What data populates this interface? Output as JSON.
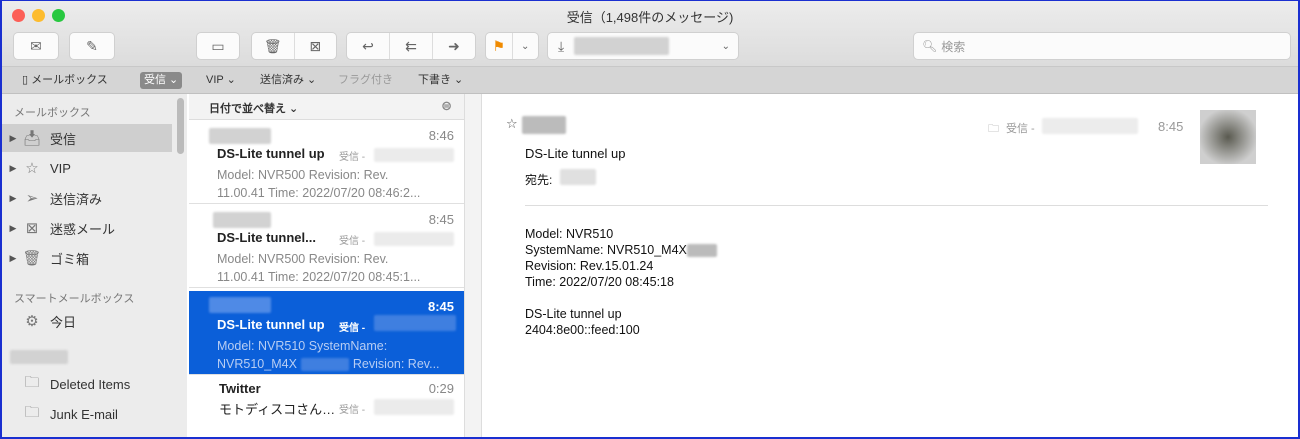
{
  "window": {
    "title": "受信（1,498件のメッセージ)"
  },
  "toolbar": {
    "search_placeholder": "検索"
  },
  "favorites": [
    {
      "label": "メールボックス"
    },
    {
      "label": "受信 ⌄"
    },
    {
      "label": "VIP ⌄"
    },
    {
      "label": "送信済み ⌄"
    },
    {
      "label": "フラグ付き"
    },
    {
      "label": "下書き ⌄"
    }
  ],
  "sidebar": {
    "section_mailboxes": "メールボックス",
    "items": [
      {
        "label": "受信",
        "icon": "inbox-icon"
      },
      {
        "label": "VIP",
        "icon": "star-icon"
      },
      {
        "label": "送信済み",
        "icon": "paperplane-icon"
      },
      {
        "label": "迷惑メール",
        "icon": "junk-icon"
      },
      {
        "label": "ゴミ箱",
        "icon": "trash-icon"
      }
    ],
    "section_smart": "スマートメールボックス",
    "smart_items": [
      {
        "label": "今日"
      }
    ],
    "account_items": [
      {
        "label": "Deleted Items"
      },
      {
        "label": "Junk E-mail"
      }
    ]
  },
  "list": {
    "sort_label": "日付で並べ替え ⌄",
    "messages": [
      {
        "time": "8:46",
        "subject": "DS-Lite tunnel up",
        "mailbox": "受信 -",
        "preview1": "Model: NVR500 Revision: Rev.",
        "preview2": "11.00.41 Time: 2022/07/20 08:46:2..."
      },
      {
        "time": "8:45",
        "subject": "DS-Lite tunnel...",
        "mailbox": "受信 -",
        "preview1": "Model: NVR500 Revision: Rev.",
        "preview2": "11.00.41 Time: 2022/07/20 08:45:1..."
      },
      {
        "time": "8:45",
        "subject": "DS-Lite tunnel up",
        "mailbox": "受信 -",
        "preview1": "Model: NVR510 SystemName:",
        "preview2": "NVR510_M4X",
        "preview2b": "Revision: Rev..."
      },
      {
        "sender": "Twitter",
        "time": "0:29",
        "subject": "モトディスコさん…",
        "mailbox": "受信 -"
      }
    ]
  },
  "detail": {
    "mailbox": "受信 -",
    "time": "8:45",
    "subject": "DS-Lite tunnel up",
    "to_label": "宛先:",
    "body": [
      "Model: NVR510",
      "SystemName: NVR510_M4X",
      "Revision: Rev.15.01.24",
      "Time: 2022/07/20 08:45:18",
      "",
      "DS-Lite tunnel up",
      "2404:8e00::feed:100"
    ]
  }
}
